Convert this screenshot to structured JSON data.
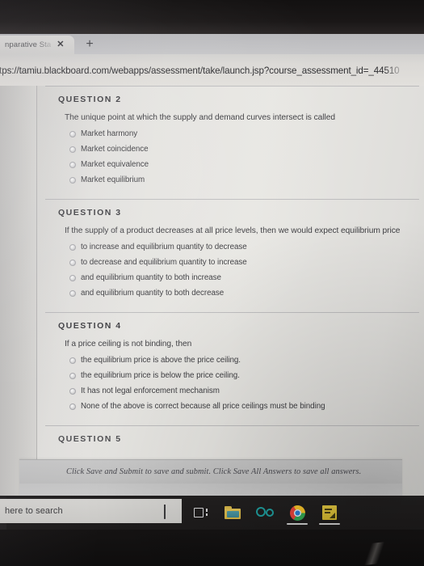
{
  "browser": {
    "tab_title": "nparative Sta",
    "tab_close_label": "✕",
    "new_tab_label": "+",
    "url": "ttps://tamiu.blackboard.com/webapps/assessment/take/launch.jsp?course_assessment_id=_44510"
  },
  "assessment": {
    "questions": [
      {
        "header": "QUESTION 2",
        "stem": "The unique point at which the supply and demand curves intersect is called",
        "options": [
          "Market harmony",
          "Market coincidence",
          "Market equivalence",
          "Market equilibrium"
        ]
      },
      {
        "header": "QUESTION 3",
        "stem": "If the supply of a product decreases at all price levels, then we would expect equilibrium price",
        "options": [
          "to increase and equilibrium quantity to decrease",
          "to decrease and equilibrium quantity to increase",
          "and equilibrium quantity to both increase",
          "and equilibrium quantity to both decrease"
        ]
      },
      {
        "header": "QUESTION 4",
        "stem": "If a price ceiling is not binding, then",
        "options": [
          "the equilibrium price is above the price ceiling.",
          "the equilibrium price is below the price ceiling.",
          "It has not legal enforcement mechanism",
          "None of the above is correct because all price ceilings must be binding"
        ]
      }
    ],
    "partial_question_header": "QUESTION 5",
    "save_bar_text": "Click Save and Submit to save and submit. Click Save All Answers to save all answers."
  },
  "taskbar": {
    "search_placeholder": "here to search",
    "items": [
      {
        "name": "task-view",
        "label": "Task View"
      },
      {
        "name": "file-explorer",
        "label": "File Explorer"
      },
      {
        "name": "microsoft-edge",
        "label": "Microsoft Edge"
      },
      {
        "name": "google-chrome",
        "label": "Google Chrome"
      },
      {
        "name": "sticky-notes",
        "label": "Sticky Notes"
      }
    ]
  },
  "colors": {
    "page_bg": "#e8e7e3",
    "text": "#3d3d41",
    "savebar_bg": "#c4c4c4",
    "taskbar_bg": "#1f1d1d"
  }
}
